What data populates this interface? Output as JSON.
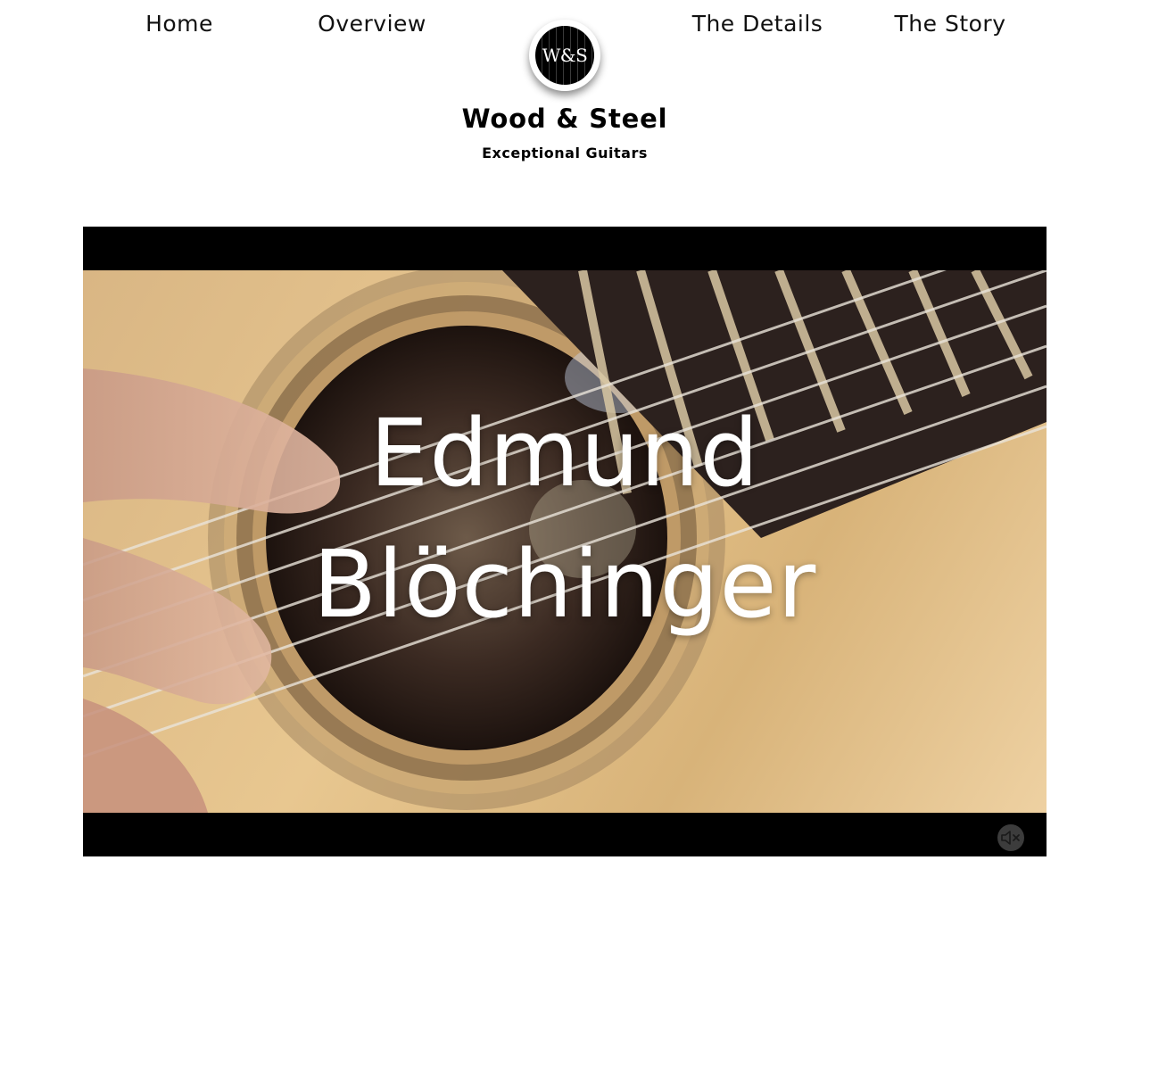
{
  "nav": {
    "items": [
      {
        "label": "Home"
      },
      {
        "label": "Overview"
      },
      {
        "label": "The Details"
      },
      {
        "label": "The Story"
      }
    ]
  },
  "logo": {
    "text": "W&S",
    "icon": "guitar-strings-logo-icon"
  },
  "site": {
    "title": "Wood & Steel",
    "subtitle": "Exceptional Guitars"
  },
  "video": {
    "caption_line1": "Edmund",
    "caption_line2": "Blöchinger",
    "mute_icon": "volume-muted-icon",
    "muted": true
  },
  "colors": {
    "video_background": "#000000",
    "page_background": "#ffffff",
    "text": "#111111"
  }
}
